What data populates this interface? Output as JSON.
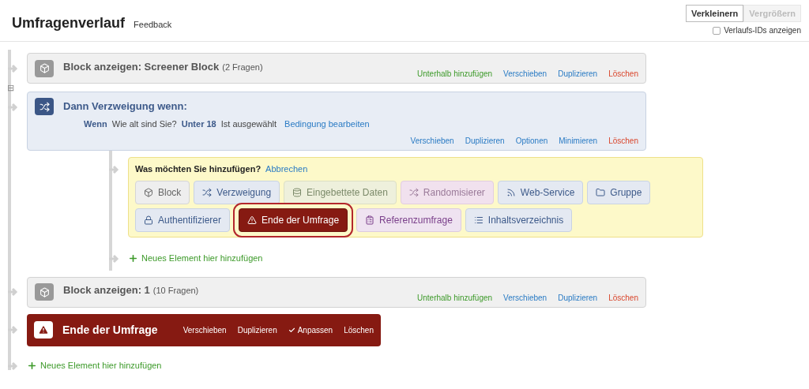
{
  "header": {
    "title": "Umfragenverlauf",
    "subtitle": "Feedback",
    "buttons": [
      {
        "label": "Verkleinern",
        "disabled": false
      },
      {
        "label": "Vergrößern",
        "disabled": true
      }
    ],
    "show_ids": {
      "label": "Verlaufs-IDs anzeigen",
      "checked": false
    }
  },
  "flow": [
    {
      "kind": "block",
      "title": "Block anzeigen: Screener Block",
      "count": "(2 Fragen)",
      "actions": [
        {
          "label": "Unterhalb hinzufügen",
          "kind": "add"
        },
        {
          "label": "Verschieben",
          "kind": "link"
        },
        {
          "label": "Duplizieren",
          "kind": "link"
        },
        {
          "label": "Löschen",
          "kind": "delete"
        }
      ]
    },
    {
      "kind": "branch",
      "collapse": "⊟",
      "title": "Dann Verzweigung wenn:",
      "condition": {
        "prefix": "Wenn",
        "question": "Wie alt sind Sie?",
        "choice": "Unter 18",
        "state": "Ist ausgewählt",
        "edit": "Bedingung bearbeiten"
      },
      "actions": [
        {
          "label": "Verschieben",
          "kind": "link"
        },
        {
          "label": "Duplizieren",
          "kind": "link"
        },
        {
          "label": "Optionen",
          "kind": "link"
        },
        {
          "label": "Minimieren",
          "kind": "link"
        },
        {
          "label": "Löschen",
          "kind": "delete"
        }
      ],
      "add_panel": {
        "prompt": "Was möchten Sie hinzufügen?",
        "cancel": "Abbrechen",
        "options": [
          {
            "kind": "block",
            "label": "Block",
            "selected": false
          },
          {
            "kind": "branch",
            "label": "Verzweigung",
            "selected": false
          },
          {
            "kind": "embedded",
            "label": "Eingebettete Daten",
            "selected": false
          },
          {
            "kind": "randomizer",
            "label": "Randomisierer",
            "selected": false
          },
          {
            "kind": "webservice",
            "label": "Web-Service",
            "selected": false
          },
          {
            "kind": "group",
            "label": "Gruppe",
            "selected": false
          },
          {
            "kind": "auth",
            "label": "Authentifizierer",
            "selected": false
          },
          {
            "kind": "end",
            "label": "Ende der Umfrage",
            "selected": true
          },
          {
            "kind": "reference",
            "label": "Referenzumfrage",
            "selected": false
          },
          {
            "kind": "toc",
            "label": "Inhaltsverzeichnis",
            "selected": false
          }
        ]
      },
      "add_link": "Neues Element hier hinzufügen"
    },
    {
      "kind": "block",
      "title": "Block anzeigen: 1",
      "count": "(10 Fragen)",
      "actions": [
        {
          "label": "Unterhalb hinzufügen",
          "kind": "add"
        },
        {
          "label": "Verschieben",
          "kind": "link"
        },
        {
          "label": "Duplizieren",
          "kind": "link"
        },
        {
          "label": "Löschen",
          "kind": "delete"
        }
      ]
    },
    {
      "kind": "end",
      "title": "Ende der Umfrage",
      "actions": [
        {
          "label": "Verschieben",
          "checked": false
        },
        {
          "label": "Duplizieren",
          "checked": false
        },
        {
          "label": "Anpassen",
          "checked": true
        },
        {
          "label": "Löschen",
          "checked": false
        }
      ]
    }
  ],
  "add_link": "Neues Element hier hinzufügen"
}
